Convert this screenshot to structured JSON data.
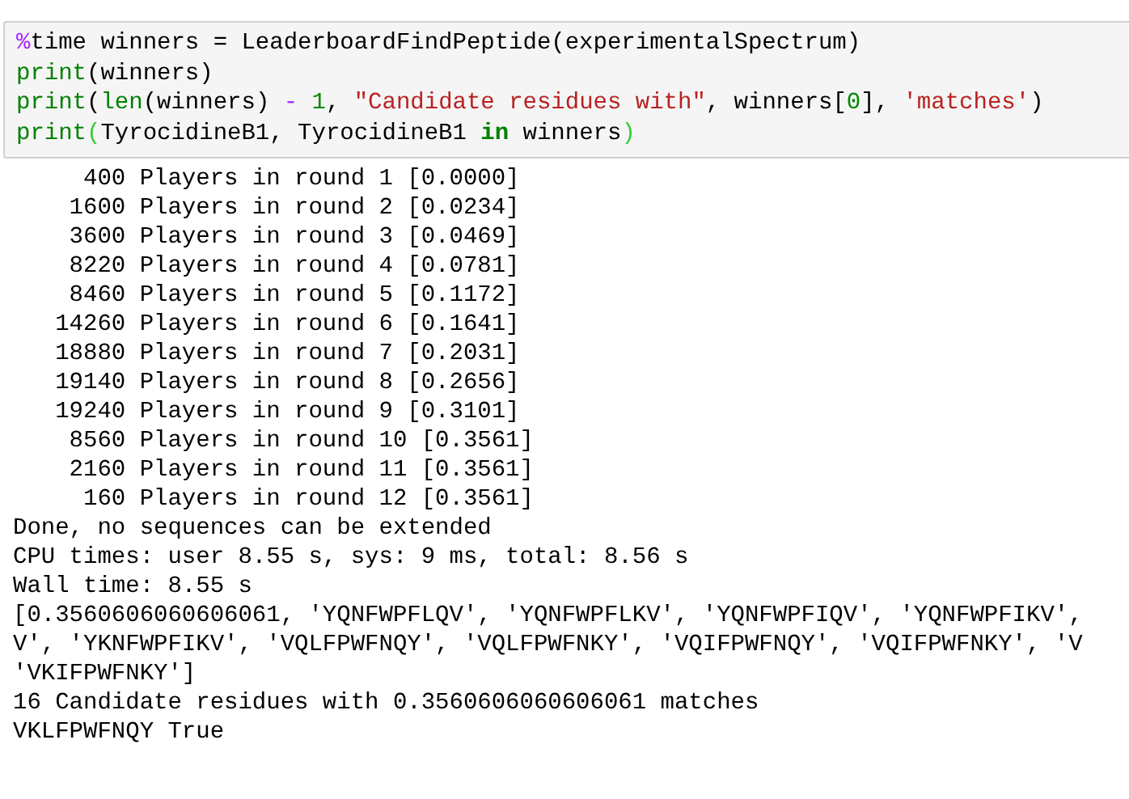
{
  "code_cell": {
    "lines": [
      [
        {
          "kind": "magic",
          "text": "%"
        },
        {
          "kind": "plain",
          "text": "time winners = LeaderboardFindPeptide(experimentalSpectrum)"
        }
      ],
      [
        {
          "kind": "builtin",
          "text": "print"
        },
        {
          "kind": "plain",
          "text": "(winners)"
        }
      ],
      [
        {
          "kind": "builtin",
          "text": "print"
        },
        {
          "kind": "plain",
          "text": "("
        },
        {
          "kind": "builtin",
          "text": "len"
        },
        {
          "kind": "plain",
          "text": "(winners) "
        },
        {
          "kind": "operator",
          "text": "- "
        },
        {
          "kind": "number",
          "text": "1"
        },
        {
          "kind": "plain",
          "text": ", "
        },
        {
          "kind": "string",
          "text": "\"Candidate residues with\""
        },
        {
          "kind": "plain",
          "text": ", winners["
        },
        {
          "kind": "number",
          "text": "0"
        },
        {
          "kind": "plain",
          "text": "], "
        },
        {
          "kind": "string",
          "text": "'matches'"
        },
        {
          "kind": "plain",
          "text": ")"
        }
      ],
      [
        {
          "kind": "builtin",
          "text": "print"
        },
        {
          "kind": "bracket",
          "text": "("
        },
        {
          "kind": "plain",
          "text": "TyrocidineB1, TyrocidineB1 "
        },
        {
          "kind": "keyword",
          "text": "in"
        },
        {
          "kind": "plain",
          "text": " winners"
        },
        {
          "kind": "bracket",
          "text": ")"
        }
      ]
    ]
  },
  "output": [
    "     400 Players in round 1 [0.0000]",
    "    1600 Players in round 2 [0.0234]",
    "    3600 Players in round 3 [0.0469]",
    "    8220 Players in round 4 [0.0781]",
    "    8460 Players in round 5 [0.1172]",
    "   14260 Players in round 6 [0.1641]",
    "   18880 Players in round 7 [0.2031]",
    "   19140 Players in round 8 [0.2656]",
    "   19240 Players in round 9 [0.3101]",
    "    8560 Players in round 10 [0.3561]",
    "    2160 Players in round 11 [0.3561]",
    "     160 Players in round 12 [0.3561]",
    "Done, no sequences can be extended",
    "CPU times: user 8.55 s, sys: 9 ms, total: 8.56 s",
    "Wall time: 8.55 s",
    "[0.3560606060606061, 'YQNFWPFLQV', 'YQNFWPFLKV', 'YQNFWPFIQV', 'YQNFWPFIKV',",
    "V', 'YKNFWPFIKV', 'VQLFPWFNQY', 'VQLFPWFNKY', 'VQIFPWFNQY', 'VQIFPWFNKY', 'V",
    "'VKIFPWFNKY']",
    "16 Candidate residues with 0.3560606060606061 matches",
    "VKLFPWFNQY True"
  ]
}
